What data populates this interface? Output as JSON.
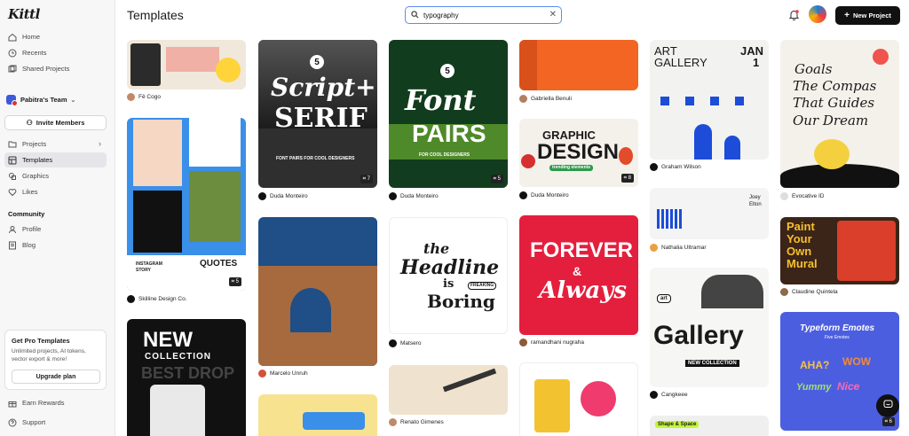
{
  "app": {
    "logo": "Kittl"
  },
  "sidebar": {
    "nav_top": [
      {
        "label": "Home",
        "icon": "home-icon"
      },
      {
        "label": "Recents",
        "icon": "clock-icon"
      },
      {
        "label": "Shared Projects",
        "icon": "shared-icon"
      }
    ],
    "team_name": "Pabitra's Team",
    "invite_label": "Invite Members",
    "nav_main": [
      {
        "label": "Projects",
        "icon": "folder-icon"
      },
      {
        "label": "Templates",
        "icon": "template-icon"
      },
      {
        "label": "Graphics",
        "icon": "graphics-icon"
      },
      {
        "label": "Likes",
        "icon": "heart-icon"
      }
    ],
    "community_label": "Community",
    "nav_community": [
      {
        "label": "Profile",
        "icon": "profile-icon"
      },
      {
        "label": "Blog",
        "icon": "blog-icon"
      }
    ],
    "pro": {
      "title": "Get Pro Templates",
      "text": "Unlimited projects, AI tokens, vector export & more!",
      "button": "Upgrade plan"
    },
    "nav_bottom": [
      {
        "label": "Earn Rewards",
        "icon": "gift-icon"
      },
      {
        "label": "Support",
        "icon": "help-circle-icon"
      }
    ]
  },
  "header": {
    "title": "Templates",
    "search_value": "typography",
    "new_project": "New Project"
  },
  "cards": [
    {
      "author": "Fê Cogo"
    },
    {
      "author": "Skilline Design Co.",
      "count": "5",
      "text": [
        "INSTAGRAM",
        "STORY",
        "QUOTES"
      ]
    },
    {
      "text": [
        "NEW",
        "COLLECTION",
        "BEST DROP"
      ]
    },
    {
      "author": "Duda Monteiro",
      "count": "7",
      "text": [
        "Script+",
        "SERIF",
        "FONT PAIRS FOR COOL DESIGNERS"
      ]
    },
    {
      "author": "Marcelo Unruh"
    },
    {
      "author": "Duda Monteiro",
      "count": "5",
      "text": [
        "Font",
        "PAIRS",
        "FOR COOL DESIGNERS"
      ]
    },
    {
      "author": "Matsero",
      "text": [
        "the",
        "Headline",
        "is",
        "Boring",
        "FREAKING"
      ]
    },
    {
      "author": "Renato Gimenes"
    },
    {
      "author": "Gabriella Benuli"
    },
    {
      "author": "Duda Monteiro",
      "count": "8",
      "text": [
        "GRAPHIC",
        "DESIGN",
        "trending elements"
      ]
    },
    {
      "author": "ramandhani nugraha",
      "text": [
        "FOREVER",
        "&",
        "Always"
      ]
    },
    {
      "author": "Graham Wilson",
      "text": [
        "ART",
        "GALLERY",
        "JAN",
        "1"
      ]
    },
    {
      "author": "Nathalia Ultramar",
      "text": [
        "Joey",
        "Elton"
      ]
    },
    {
      "author": "Cangkeee",
      "text": [
        "art",
        "Gallery",
        "NEW COLLECTION"
      ]
    },
    {
      "text": [
        "Shape & Space"
      ]
    },
    {
      "author": "Evocative ID",
      "text": [
        "Goals",
        "The Compas",
        "That Guides",
        "Our Dream"
      ]
    },
    {
      "author": "Claudine Quintela",
      "text": [
        "Paint",
        "Your",
        "Own",
        "Mural"
      ]
    },
    {
      "count": "6",
      "text": [
        "Typeform Emotes",
        "Five Emotes",
        "AHA?",
        "WOW",
        "Yummy",
        "Nice"
      ]
    }
  ]
}
